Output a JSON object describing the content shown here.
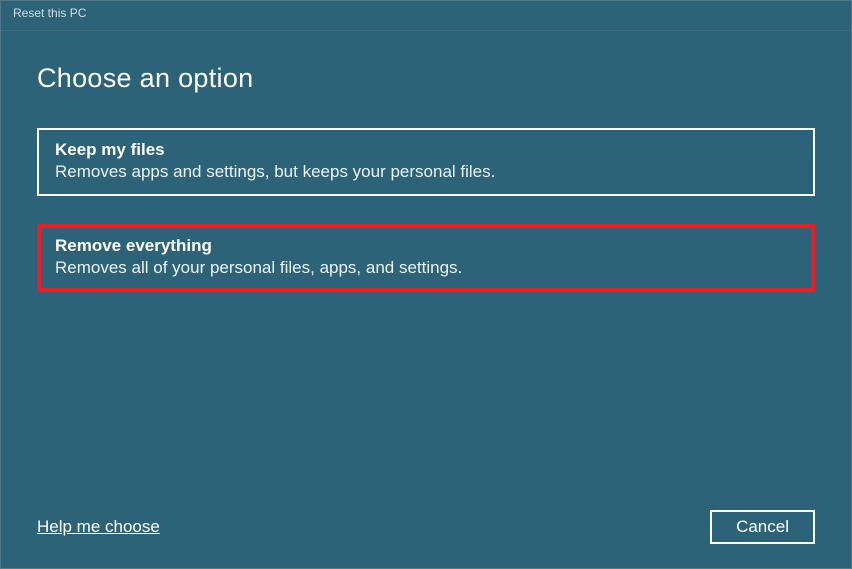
{
  "window": {
    "title": "Reset this PC"
  },
  "heading": "Choose an option",
  "options": [
    {
      "title": "Keep my files",
      "description": "Removes apps and settings, but keeps your personal files."
    },
    {
      "title": "Remove everything",
      "description": "Removes all of your personal files, apps, and settings."
    }
  ],
  "footer": {
    "help_link": "Help me choose",
    "cancel_label": "Cancel"
  },
  "colors": {
    "background": "#2c6379",
    "highlight_border": "#ed1c24"
  }
}
